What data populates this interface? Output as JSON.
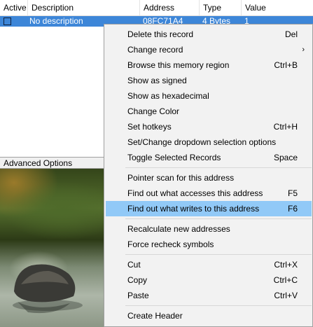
{
  "address_list": {
    "columns": [
      "Active",
      "Description",
      "Address",
      "Type",
      "Value"
    ],
    "rows": [
      {
        "active": false,
        "description": "No description",
        "address": "08FC71A4",
        "type": "4 Bytes",
        "value": "1"
      }
    ]
  },
  "advanced_options_label": "Advanced Options",
  "context_menu": {
    "items": [
      {
        "label": "Delete this record",
        "shortcut": "Del"
      },
      {
        "label": "Change record",
        "shortcut": "",
        "submenu_icon": "chevron-right-icon"
      },
      {
        "label": "Browse this memory region",
        "shortcut": "Ctrl+B"
      },
      {
        "label": "Show as signed",
        "shortcut": ""
      },
      {
        "label": "Show as hexadecimal",
        "shortcut": ""
      },
      {
        "label": "Change Color",
        "shortcut": ""
      },
      {
        "label": "Set hotkeys",
        "shortcut": "Ctrl+H"
      },
      {
        "label": "Set/Change dropdown selection options",
        "shortcut": ""
      },
      {
        "label": "Toggle Selected Records",
        "shortcut": "Space"
      },
      {
        "label": "Pointer scan for this address",
        "shortcut": ""
      },
      {
        "label": "Find out what accesses this address",
        "shortcut": "F5"
      },
      {
        "label": "Find out what writes to this address",
        "shortcut": "F6",
        "highlighted": true
      },
      {
        "label": "Recalculate new addresses",
        "shortcut": ""
      },
      {
        "label": "Force recheck symbols",
        "shortcut": ""
      },
      {
        "label": "Cut",
        "shortcut": "Ctrl+X"
      },
      {
        "label": "Copy",
        "shortcut": "Ctrl+C"
      },
      {
        "label": "Paste",
        "shortcut": "Ctrl+V"
      },
      {
        "label": "Create Header",
        "shortcut": ""
      }
    ]
  },
  "colors": {
    "selection_row": "#3d86d8",
    "menu_highlight": "#91c9f7",
    "menu_background": "#f2f2f2"
  }
}
